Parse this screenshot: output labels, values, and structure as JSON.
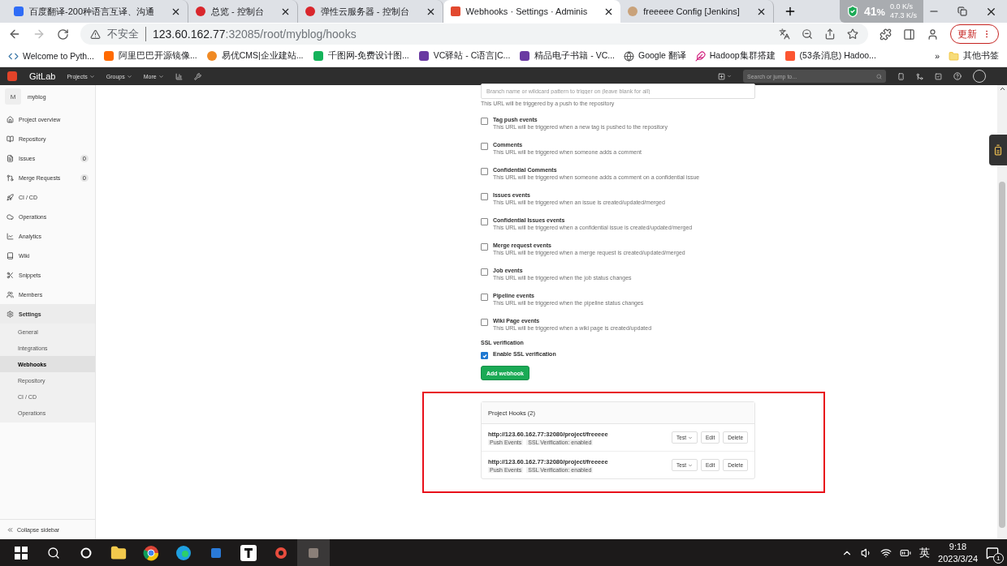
{
  "browser": {
    "tabs": [
      {
        "title": "百度翻译-200种语言互译、沟通",
        "selected": false
      },
      {
        "title": "总览 - 控制台",
        "selected": false
      },
      {
        "title": "弹性云服务器 - 控制台",
        "selected": false
      },
      {
        "title": "Webhooks · Settings · Adminis",
        "selected": true
      },
      {
        "title": "freeeee Config [Jenkins]",
        "selected": false
      }
    ],
    "net_widget": {
      "percent": "41",
      "unit": "%",
      "up": "0.0 K/s",
      "down": "47.3 K/s"
    },
    "address": {
      "insecure_label": "不安全",
      "host": "123.60.162.77",
      "path": ":32085/root/myblog/hooks"
    },
    "update_button": "更新",
    "bookmarks": [
      {
        "label": "Welcome to Pyth..."
      },
      {
        "label": "阿里巴巴开源镜像..."
      },
      {
        "label": "易优CMS|企业建站..."
      },
      {
        "label": "千图网-免费设计图..."
      },
      {
        "label": "VC驿站 - C语言|C..."
      },
      {
        "label": "精品电子书籍 - VC..."
      },
      {
        "label": "Google 翻译"
      },
      {
        "label": "Hadoop集群搭建"
      },
      {
        "label": "(53条消息) Hadoo..."
      }
    ],
    "bookmarks_overflow": "»",
    "other_bookmarks": "其他书签"
  },
  "gitlab_nav": {
    "brand": "GitLab",
    "menus": [
      "Projects",
      "Groups",
      "More"
    ],
    "search_placeholder": "Search or jump to..."
  },
  "sidebar": {
    "project": {
      "initial": "M",
      "name": "myblog"
    },
    "items": [
      {
        "label": "Project overview",
        "selected": false
      },
      {
        "label": "Repository",
        "selected": false
      },
      {
        "label": "Issues",
        "count": "0",
        "selected": false
      },
      {
        "label": "Merge Requests",
        "count": "0",
        "selected": false
      },
      {
        "label": "CI / CD",
        "selected": false
      },
      {
        "label": "Operations",
        "selected": false
      },
      {
        "label": "Analytics",
        "selected": false
      },
      {
        "label": "Wiki",
        "selected": false
      },
      {
        "label": "Snippets",
        "selected": false
      },
      {
        "label": "Members",
        "selected": false
      },
      {
        "label": "Settings",
        "selected": true,
        "children": [
          {
            "label": "General",
            "selected": false
          },
          {
            "label": "Integrations",
            "selected": false
          },
          {
            "label": "Webhooks",
            "selected": true
          },
          {
            "label": "Repository",
            "selected": false
          },
          {
            "label": "CI / CD",
            "selected": false
          },
          {
            "label": "Operations",
            "selected": false
          }
        ]
      }
    ],
    "collapse": "Collapse sidebar"
  },
  "form": {
    "branch_placeholder": "Branch name or wildcard pattern to trigger on (leave blank for all)",
    "branch_hint": "This URL will be triggered by a push to the repository",
    "events": [
      {
        "label": "Tag push events",
        "hint": "This URL will be triggered when a new tag is pushed to the repository",
        "checked": false
      },
      {
        "label": "Comments",
        "hint": "This URL will be triggered when someone adds a comment",
        "checked": false
      },
      {
        "label": "Confidential Comments",
        "hint": "This URL will be triggered when someone adds a comment on a confidential issue",
        "checked": false
      },
      {
        "label": "Issues events",
        "hint": "This URL will be triggered when an issue is created/updated/merged",
        "checked": false
      },
      {
        "label": "Confidential Issues events",
        "hint": "This URL will be triggered when a confidential issue is created/updated/merged",
        "checked": false
      },
      {
        "label": "Merge request events",
        "hint": "This URL will be triggered when a merge request is created/updated/merged",
        "checked": false
      },
      {
        "label": "Job events",
        "hint": "This URL will be triggered when the job status changes",
        "checked": false
      },
      {
        "label": "Pipeline events",
        "hint": "This URL will be triggered when the pipeline status changes",
        "checked": false
      },
      {
        "label": "Wiki Page events",
        "hint": "This URL will be triggered when a wiki page is created/updated",
        "checked": false
      }
    ],
    "ssl_heading": "SSL verification",
    "ssl": {
      "label": "Enable SSL verification",
      "checked": true
    },
    "submit": "Add webhook"
  },
  "hooks": {
    "title": "Project Hooks (2)",
    "items": [
      {
        "url": "http://123.60.162.77:32080/project/freeeee",
        "tags": [
          "Push Events",
          "SSL Verification: enabled"
        ],
        "test": "Test",
        "edit": "Edit",
        "delete": "Delete"
      },
      {
        "url": "http://123.60.162.77:32080/project/freeeee",
        "tags": [
          "Push Events",
          "SSL Verification: enabled"
        ],
        "test": "Test",
        "edit": "Edit",
        "delete": "Delete"
      }
    ]
  },
  "taskbar": {
    "ime": "英",
    "time": "9:18",
    "date": "2023/3/24",
    "notifications": "1"
  }
}
